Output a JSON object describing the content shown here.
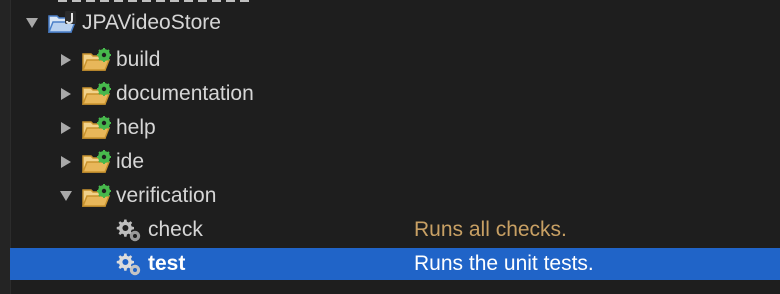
{
  "tree": {
    "root": {
      "label": "JPAVideoStore",
      "icon": "gradle-project-icon",
      "expanded": true
    },
    "groups": [
      {
        "label": "build",
        "icon": "task-group-folder-icon",
        "expanded": false
      },
      {
        "label": "documentation",
        "icon": "task-group-folder-icon",
        "expanded": false
      },
      {
        "label": "help",
        "icon": "task-group-folder-icon",
        "expanded": false
      },
      {
        "label": "ide",
        "icon": "task-group-folder-icon",
        "expanded": false
      },
      {
        "label": "verification",
        "icon": "task-group-folder-icon",
        "expanded": true
      }
    ],
    "tasks": [
      {
        "label": "check",
        "description": "Runs all checks.",
        "icon": "gear-icon",
        "selected": false
      },
      {
        "label": "test",
        "description": "Runs the unit tests.",
        "icon": "gear-icon",
        "selected": true
      }
    ]
  },
  "colors": {
    "background": "#1e1e1e",
    "selection": "#2064c8",
    "description_text": "#c8a064",
    "folder": "#e8b75a",
    "gear_badge": "#47b84c"
  }
}
